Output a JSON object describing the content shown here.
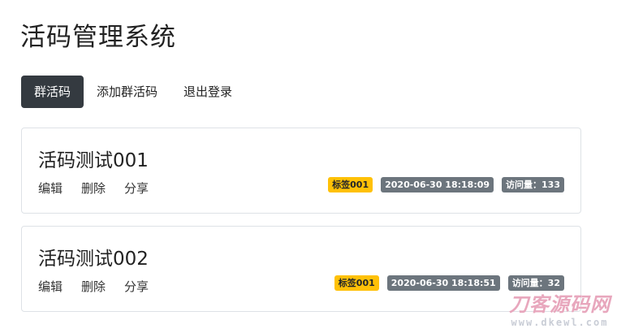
{
  "header": {
    "title": "活码管理系统"
  },
  "nav": {
    "items": [
      {
        "label": "群活码",
        "active": true
      },
      {
        "label": "添加群活码",
        "active": false
      },
      {
        "label": "退出登录",
        "active": false
      }
    ]
  },
  "cards": [
    {
      "title": "活码测试001",
      "actions": [
        "编辑",
        "删除",
        "分享"
      ],
      "tag": "标签001",
      "timestamp": "2020-06-30 18:18:09",
      "visits": "访问量：133"
    },
    {
      "title": "活码测试002",
      "actions": [
        "编辑",
        "删除",
        "分享"
      ],
      "tag": "标签001",
      "timestamp": "2020-06-30 18:18:51",
      "visits": "访问量：32"
    }
  ],
  "watermark": {
    "main": "刀客源码网",
    "sub": "www.dkewl.com"
  },
  "colors": {
    "active_nav": "#343a40",
    "tag_badge": "#ffc107",
    "meta_badge": "#6c757d"
  }
}
